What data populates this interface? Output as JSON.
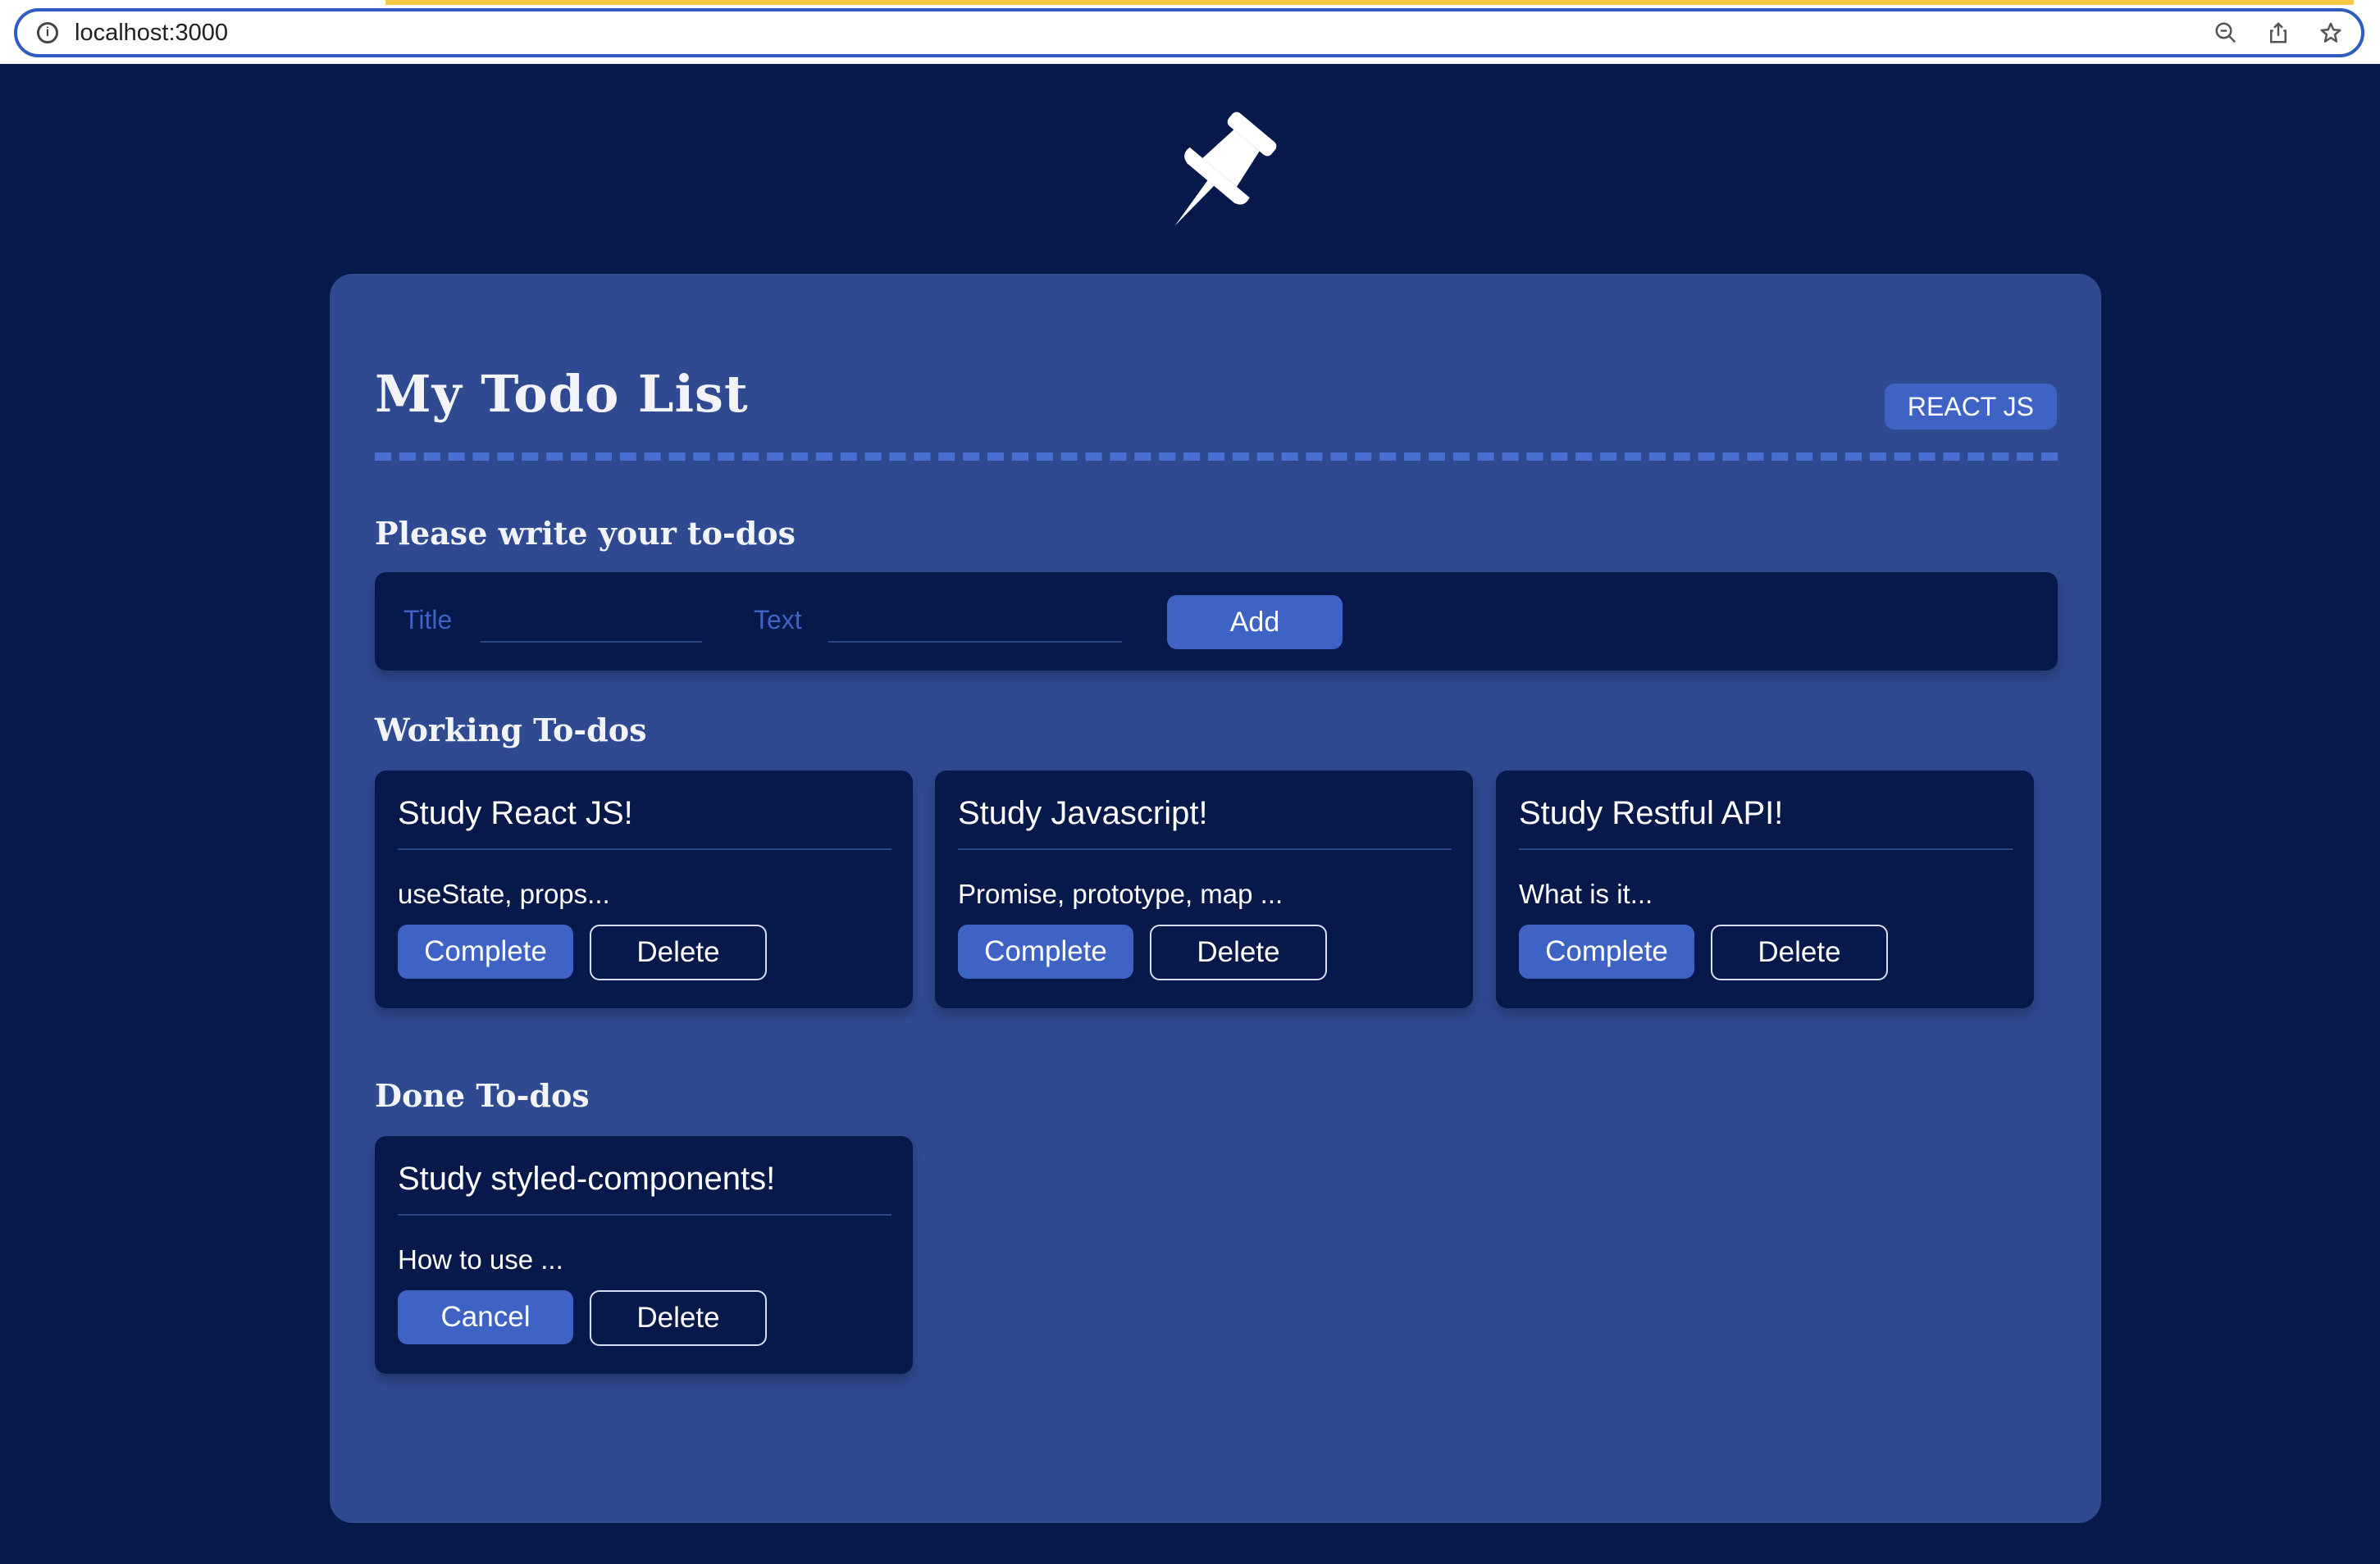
{
  "browser": {
    "url": "localhost:3000",
    "icons": [
      "info-icon",
      "zoom-out-icon",
      "share-icon",
      "bookmark-star-icon"
    ]
  },
  "logo": {
    "icon": "pushpin-icon"
  },
  "header": {
    "title": "My Todo List",
    "badge": "REACT JS"
  },
  "form": {
    "heading": "Please write your to-dos",
    "title_label": "Title",
    "title_value": "",
    "text_label": "Text",
    "text_value": "",
    "add_label": "Add"
  },
  "working": {
    "heading": "Working To-dos",
    "items": [
      {
        "title": "Study React JS!",
        "text": "useState, props...",
        "primary": "Complete",
        "secondary": "Delete"
      },
      {
        "title": "Study Javascript!",
        "text": "Promise, prototype, map ...",
        "primary": "Complete",
        "secondary": "Delete"
      },
      {
        "title": "Study Restful API!",
        "text": "What is it...",
        "primary": "Complete",
        "secondary": "Delete"
      }
    ]
  },
  "done": {
    "heading": "Done To-dos",
    "items": [
      {
        "title": "Study styled-components!",
        "text": "How to use ...",
        "primary": "Cancel",
        "secondary": "Delete"
      }
    ]
  },
  "colors": {
    "background": "#06194a",
    "panel": "#304a92",
    "accent": "#3f63c4",
    "text": "#ffffff"
  }
}
